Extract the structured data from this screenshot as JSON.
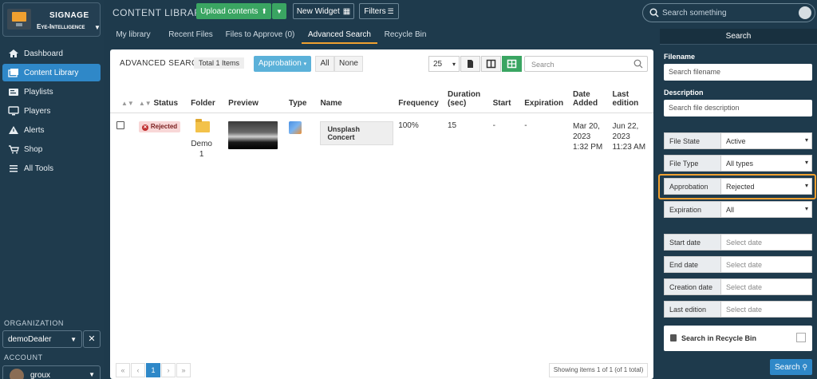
{
  "brand": {
    "title": "SIGNAGE",
    "subtitle": "Eye-Intelligence"
  },
  "nav": [
    {
      "label": "Dashboard"
    },
    {
      "label": "Content Library"
    },
    {
      "label": "Playlists"
    },
    {
      "label": "Players"
    },
    {
      "label": "Alerts"
    },
    {
      "label": "Shop"
    },
    {
      "label": "All Tools"
    }
  ],
  "organization": {
    "label": "ORGANIZATION",
    "value": "demoDealer"
  },
  "account": {
    "label": "ACCOUNT",
    "name": "groux"
  },
  "header": {
    "title": "CONTENT LIBRARY",
    "upload_label": "Upload contents",
    "new_widget_label": "New Widget",
    "filters_label": "Filters",
    "search_placeholder": "Search something"
  },
  "tabs": [
    {
      "label": "My library"
    },
    {
      "label": "Recent Files"
    },
    {
      "label": "Files to Approve (0)"
    },
    {
      "label": "Advanced Search"
    },
    {
      "label": "Recycle Bin"
    }
  ],
  "main": {
    "title": "ADVANCED SEARCH",
    "total_badge": "Total 1 Items",
    "approbation_label": "Approbation",
    "all_label": "All",
    "none_label": "None",
    "page_size": "25",
    "search_placeholder": "Search",
    "columns": [
      "Status",
      "Folder",
      "Preview",
      "Type",
      "Name",
      "Frequency",
      "Duration (sec)",
      "Start",
      "Expiration",
      "Date Added",
      "Last edition"
    ],
    "rows": [
      {
        "status": "Rejected",
        "folder": "Demo 1",
        "name": "Unsplash Concert",
        "frequency": "100%",
        "duration": "15",
        "start": "-",
        "expiration": "-",
        "date_added": "Mar 20, 2023 1:32 PM",
        "last_edition": "Jun 22, 2023 11:23 AM"
      }
    ],
    "pagination": {
      "first": "«",
      "prev": "‹",
      "current": "1",
      "next": "›",
      "last": "»"
    },
    "showing": "Showing items 1 of 1 (of 1 total)"
  },
  "search_panel": {
    "header": "Search",
    "filename_label": "Filename",
    "filename_placeholder": "Search filename",
    "description_label": "Description",
    "description_placeholder": "Search file description",
    "fields": [
      {
        "label": "File State",
        "value": "Active"
      },
      {
        "label": "File Type",
        "value": "All types"
      },
      {
        "label": "Approbation",
        "value": "Rejected"
      },
      {
        "label": "Expiration",
        "value": "All"
      }
    ],
    "dates": [
      {
        "label": "Start date",
        "placeholder": "Select date"
      },
      {
        "label": "End date",
        "placeholder": "Select date"
      },
      {
        "label": "Creation date",
        "placeholder": "Select date"
      },
      {
        "label": "Last edition",
        "placeholder": "Select date"
      }
    ],
    "recycle_label": "Search in Recycle Bin",
    "search_button": "Search"
  }
}
